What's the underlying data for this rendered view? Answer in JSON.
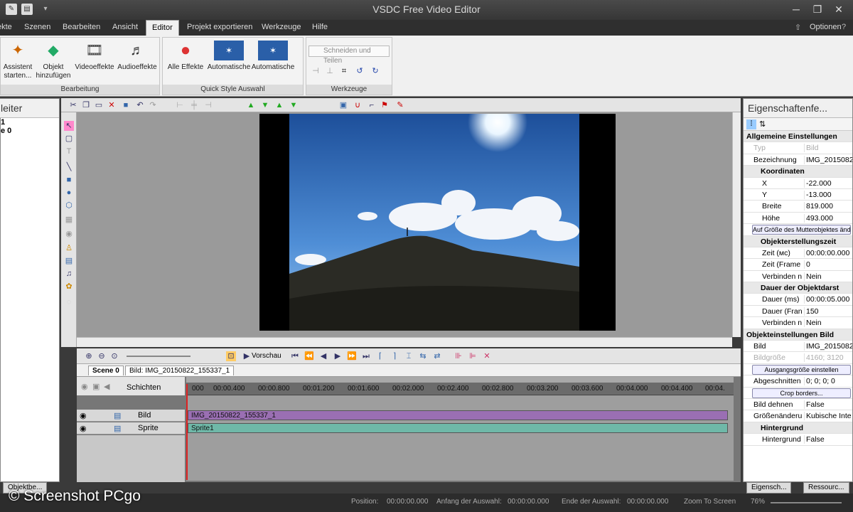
{
  "app": {
    "title": "VSDC Free Video Editor"
  },
  "menu": {
    "tabs": [
      "ekte",
      "Szenen",
      "Bearbeiten",
      "Ansicht",
      "Editor",
      "Projekt exportieren",
      "Werkzeuge",
      "Hilfe"
    ],
    "options": "Optionen"
  },
  "ribbon": {
    "assistant": "Assistent starten...",
    "add_object": "Objekt hinzufügen",
    "video_effects": "Videoeffekte",
    "audio_effects": "Audioeffekte",
    "group_edit": "Bearbeitung",
    "all_effects": "Alle Effekte",
    "auto1": "Automatische",
    "auto2": "Automatische",
    "group_quickstyle": "Quick Style Auswahl",
    "cut_split": "Schneiden und Teilen",
    "group_tools": "Werkzeuge"
  },
  "left_panel": {
    "title": "leiter",
    "items": [
      "1",
      "e 0"
    ],
    "bottom_tab": "Objektbe..."
  },
  "timeline": {
    "preview": "Vorschau",
    "scene_tab": "Scene 0",
    "image_tab": "Bild: IMG_20150822_155337_1",
    "layers_label": "Schichten",
    "ruler": [
      "000",
      "00:00.400",
      "00:00.800",
      "00:01.200",
      "00:01.600",
      "00:02.000",
      "00:02.400",
      "00:02.800",
      "00:03.200",
      "00:03.600",
      "00:04.000",
      "00:04.400",
      "00:04."
    ],
    "tracks": [
      {
        "name": "Bild",
        "clip": "IMG_20150822_155337_1",
        "color": "#9a6fb3"
      },
      {
        "name": "Sprite",
        "clip": "Sprite1",
        "color": "#6fb8a8"
      }
    ]
  },
  "properties": {
    "title": "Eigenschaftenfe...",
    "rows": [
      {
        "type": "sec",
        "k": "Allgemeine Einstellungen"
      },
      {
        "type": "grey",
        "k": "Typ",
        "v": "Bild"
      },
      {
        "type": "row",
        "k": "Bezeichnung",
        "v": "IMG_2015082"
      },
      {
        "type": "sec2",
        "k": "Koordinaten"
      },
      {
        "type": "sub",
        "k": "X",
        "v": "-22.000"
      },
      {
        "type": "sub",
        "k": "Y",
        "v": "-13.000"
      },
      {
        "type": "sub",
        "k": "Breite",
        "v": "819.000"
      },
      {
        "type": "sub",
        "k": "Höhe",
        "v": "493.000"
      },
      {
        "type": "btn",
        "k": "Auf Größe des Mutterobjektes ändern"
      },
      {
        "type": "sec2",
        "k": "Objekterstellungszeit"
      },
      {
        "type": "sub",
        "k": "Zeit (мс)",
        "v": "00:00:00.000"
      },
      {
        "type": "sub",
        "k": "Zeit (Frame",
        "v": "0"
      },
      {
        "type": "sub",
        "k": "Verbinden n",
        "v": "Nein"
      },
      {
        "type": "sec2",
        "k": "Dauer der Objektdarst"
      },
      {
        "type": "sub",
        "k": "Dauer (ms)",
        "v": "00:00:05.000"
      },
      {
        "type": "sub",
        "k": "Dauer (Fran",
        "v": "150"
      },
      {
        "type": "sub",
        "k": "Verbinden n",
        "v": "Nein"
      },
      {
        "type": "sec",
        "k": "Objekteinstellungen Bild"
      },
      {
        "type": "row",
        "k": "Bild",
        "v": "IMG_2015082"
      },
      {
        "type": "grey",
        "k": "Bildgröße",
        "v": "4160; 3120"
      },
      {
        "type": "btn",
        "k": "Ausgangsgröße einstellen"
      },
      {
        "type": "row",
        "k": "Abgeschnitten",
        "v": "0; 0; 0; 0"
      },
      {
        "type": "btn",
        "k": "Crop borders..."
      },
      {
        "type": "row",
        "k": "Bild dehnen",
        "v": "False"
      },
      {
        "type": "row",
        "k": "Größenänderu",
        "v": "Kubische Inte"
      },
      {
        "type": "sec2",
        "k": "Hintergrund"
      },
      {
        "type": "sub",
        "k": "Hintergrund",
        "v": "False"
      }
    ],
    "tab1": "Eigensch...",
    "tab2": "Ressourc..."
  },
  "status": {
    "position_label": "Position:",
    "position": "00:00:00.000",
    "sel_start_label": "Anfang der Auswahl:",
    "sel_start": "00:00:00.000",
    "sel_end_label": "Ende der Auswahl:",
    "sel_end": "00:00:00.000",
    "zoom_label": "Zoom To Screen",
    "zoom": "76%"
  },
  "watermark": "© Screenshot PCgo"
}
